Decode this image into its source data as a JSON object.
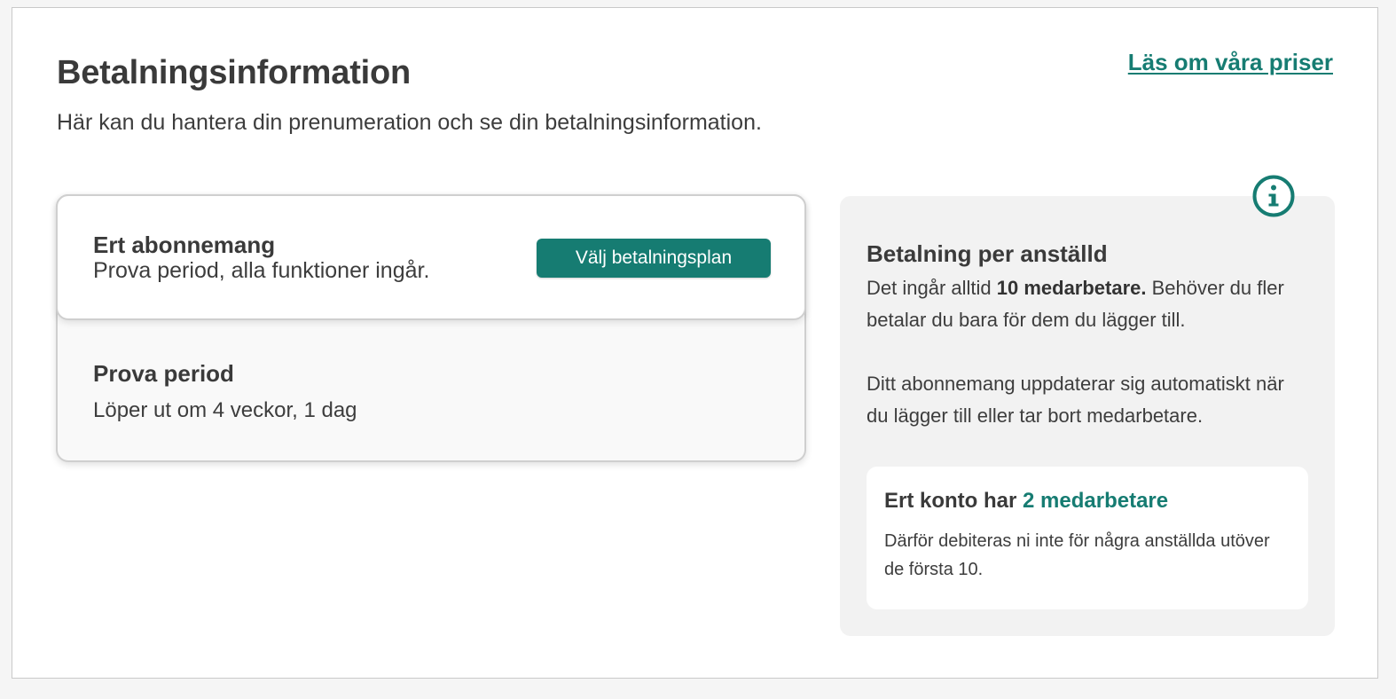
{
  "header": {
    "title": "Betalningsinformation",
    "subtitle": "Här kan du hantera din prenumeration och se din betalningsinformation.",
    "pricing_link": "Läs om våra priser"
  },
  "subscription": {
    "title": "Ert abonnemang",
    "description": "Prova period, alla funktioner ingår.",
    "button_label": "Välj betalningsplan",
    "trial_title": "Prova period",
    "trial_description": "Löper ut om 4 veckor, 1 dag"
  },
  "info": {
    "icon": "info-icon",
    "title": "Betalning per anställd",
    "p1_prefix": "Det ingår alltid ",
    "p1_bold": "10 medarbetare.",
    "p1_suffix": " Behöver du fler betalar du bara för dem du lägger till.",
    "p2": "Ditt abonnemang uppdaterar sig automatiskt när du lägger till eller tar bort medarbetare.",
    "count_prefix": "Ert konto har ",
    "count_value": "2 medarbetare",
    "count_description": "Därför debiteras ni inte för några anställda utöver de första 10."
  },
  "colors": {
    "accent": "#167c72",
    "text": "#3d3d3d",
    "info_bg": "#f2f2f2"
  }
}
